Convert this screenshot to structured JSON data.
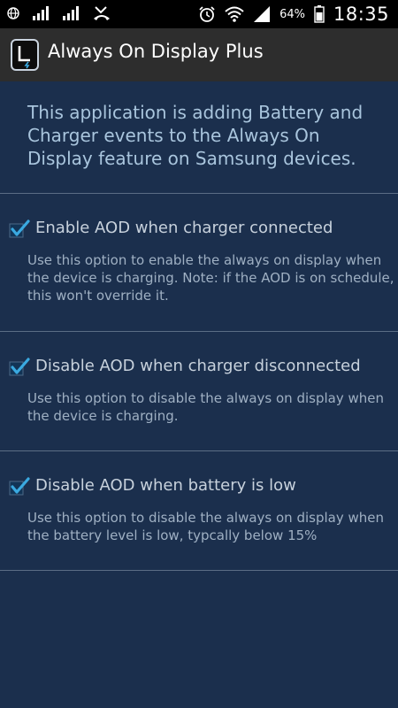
{
  "status_bar": {
    "battery_percent": "64%",
    "time": "18:35",
    "icons": [
      "globe-icon",
      "signal-icon",
      "signal-icon",
      "missed-call-icon",
      "alarm-icon",
      "wifi-icon",
      "signal-icon",
      "battery-icon"
    ]
  },
  "action_bar": {
    "title": "Always On Display Plus"
  },
  "intro_text": "This application is adding Battery and Charger events to the Always On Display feature on Samsung devices.",
  "preferences": [
    {
      "title": "Enable AOD when charger connected",
      "summary": "Use this option to enable the always on display when the device is charging. Note: if the AOD is on schedule, this won't override it.",
      "checked": true
    },
    {
      "title": "Disable AOD when charger disconnected",
      "summary": "Use this option to disable the always on display when the device is charging.",
      "checked": true
    },
    {
      "title": "Disable AOD when battery is low",
      "summary": "Use this option to disable the always on display when the battery level is low, typcally below 15%",
      "checked": true
    }
  ],
  "colors": {
    "background": "#1b2f4d",
    "action_bar": "#2d2d2d",
    "checkbox_accent": "#3aa9e0"
  }
}
